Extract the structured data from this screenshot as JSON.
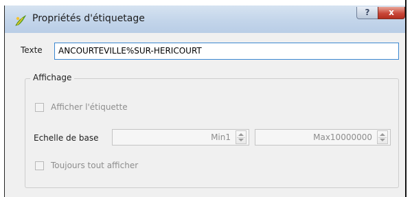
{
  "window": {
    "title": "Propriétés d'étiquetage",
    "help_button": "?",
    "close_button": "x"
  },
  "texte": {
    "label": "Texte",
    "value": "ANCOURTEVILLE%SUR-HERICOURT"
  },
  "affichage": {
    "group_title": "Affichage",
    "afficher_etiquette": {
      "label": "Afficher l'étiquette",
      "checked": false
    },
    "echelle": {
      "label": "Echelle de base",
      "min_value": "Min1",
      "max_value": "Max10000000"
    },
    "toujours_afficher": {
      "label": "Toujours tout afficher",
      "checked": false
    }
  },
  "colors": {
    "titlebar": "#c3d5ea",
    "focus_border": "#3a86d0",
    "close_red": "#c9483a",
    "disabled_text": "#8d8d8d"
  },
  "icons": [
    "qgis-icon",
    "help-icon",
    "close-icon",
    "spin-up-icon",
    "spin-down-icon"
  ]
}
